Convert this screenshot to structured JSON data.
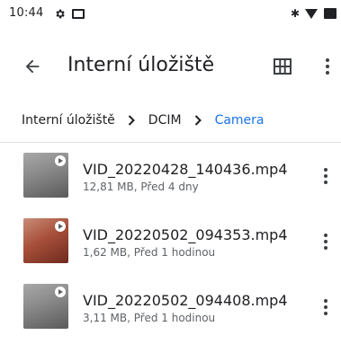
{
  "status_bar": {
    "time": "10:44",
    "icons": [
      "gear-icon",
      "screen-icon",
      "bluetooth-icon",
      "wifi-icon",
      "battery-icon"
    ]
  },
  "app_bar": {
    "title": "Interní úložiště",
    "back_icon": "arrow-left-icon",
    "view_icon": "grid-view-icon",
    "menu_icon": "more-vert-icon"
  },
  "breadcrumb": {
    "items": [
      "Interní úložiště",
      "DCIM",
      "Camera"
    ],
    "separator_icon": "chevron-right-icon",
    "accent": "#1a73e8"
  },
  "files": [
    {
      "name": "VID_20220428_140436.mp4",
      "meta": "12,81 MB, Před 4 dny",
      "thumb": "gray"
    },
    {
      "name": "VID_20220502_094353.mp4",
      "meta": "1,62 MB, Před 1 hodinou",
      "thumb": "red"
    },
    {
      "name": "VID_20220502_094408.mp4",
      "meta": "3,11 MB, Před 1 hodinou",
      "thumb": "gray"
    }
  ]
}
